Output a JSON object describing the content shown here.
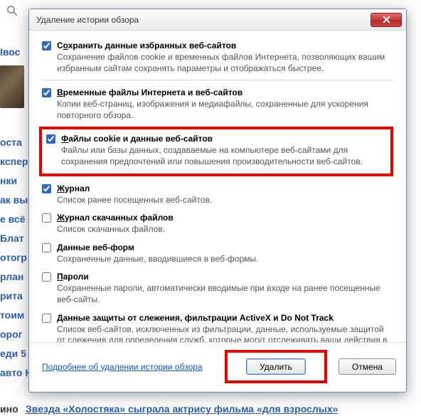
{
  "background": {
    "side_links": [
      "Iвос",
      "",
      "оста",
      "кспер",
      "нки",
      "ак вы",
      "е всё",
      "Блат",
      "отогр",
      "рлан",
      "рита",
      "тоим",
      "орог",
      "еди 5",
      "авто Н"
    ],
    "bottom_prefix": "ино",
    "bottom_link": "Звезда «Холостяка» сыграла актрису фильма «для взрослых»"
  },
  "dialog": {
    "title": "Удаление истории обзора",
    "items": [
      {
        "checked": true,
        "accel": "о",
        "title_pre": "С",
        "title_post": "хранить данные избранных веб-сайтов",
        "desc": "Сохранение файлов cookie и временных файлов Интернета, позволяющих вашим избранным сайтам сохранять параметры и отображаться быстрее."
      },
      {
        "checked": true,
        "accel": "В",
        "title_pre": "",
        "title_post": "ременные файлы Интернета и веб-сайтов",
        "desc": "Копии веб-страниц, изображения и медиафайлы, сохраненные для ускорения повторного обзора."
      },
      {
        "checked": true,
        "accel": "Ф",
        "title_pre": "",
        "title_post": "айлы cookie и данные веб-сайтов",
        "desc": "Файлы или базы данных, создаваемые на компьютере веб-сайтами для сохранения предпочтений или повышения производительности веб-сайтов."
      },
      {
        "checked": true,
        "accel": "Ж",
        "title_pre": "",
        "title_post": "урнал",
        "desc": "Список ранее посещенных веб-сайтов."
      },
      {
        "checked": false,
        "accel": "Ж",
        "title_pre": "",
        "title_post": "урнал скачанных файлов",
        "desc": "Список скачанных файлов."
      },
      {
        "checked": false,
        "accel": "Д",
        "title_pre": "",
        "title_post": "анные веб-форм",
        "desc": "Сохраненные данные, вводившиеся в веб-формы."
      },
      {
        "checked": false,
        "accel": "П",
        "title_pre": "",
        "title_post": "ароли",
        "desc": "Сохраненные пароли, автоматически вводимые при входе на ранее посещенные веб-сайты."
      },
      {
        "checked": false,
        "accel": "Д",
        "title_pre": "",
        "title_post": "анные защиты от слежения, фильтрации ActiveX и Do Not Track",
        "desc": "Список веб-сайтов, исключенных из фильтрации, данные, используемые защитой от слежения для определения служб, которые могут отслеживать ваши действия в Интернете, а также исключения для запросов Do Not Track."
      }
    ],
    "learn_more": "Подробнее об удалении истории обзора",
    "delete_btn": "Удалить",
    "cancel_btn": "Отмена"
  }
}
